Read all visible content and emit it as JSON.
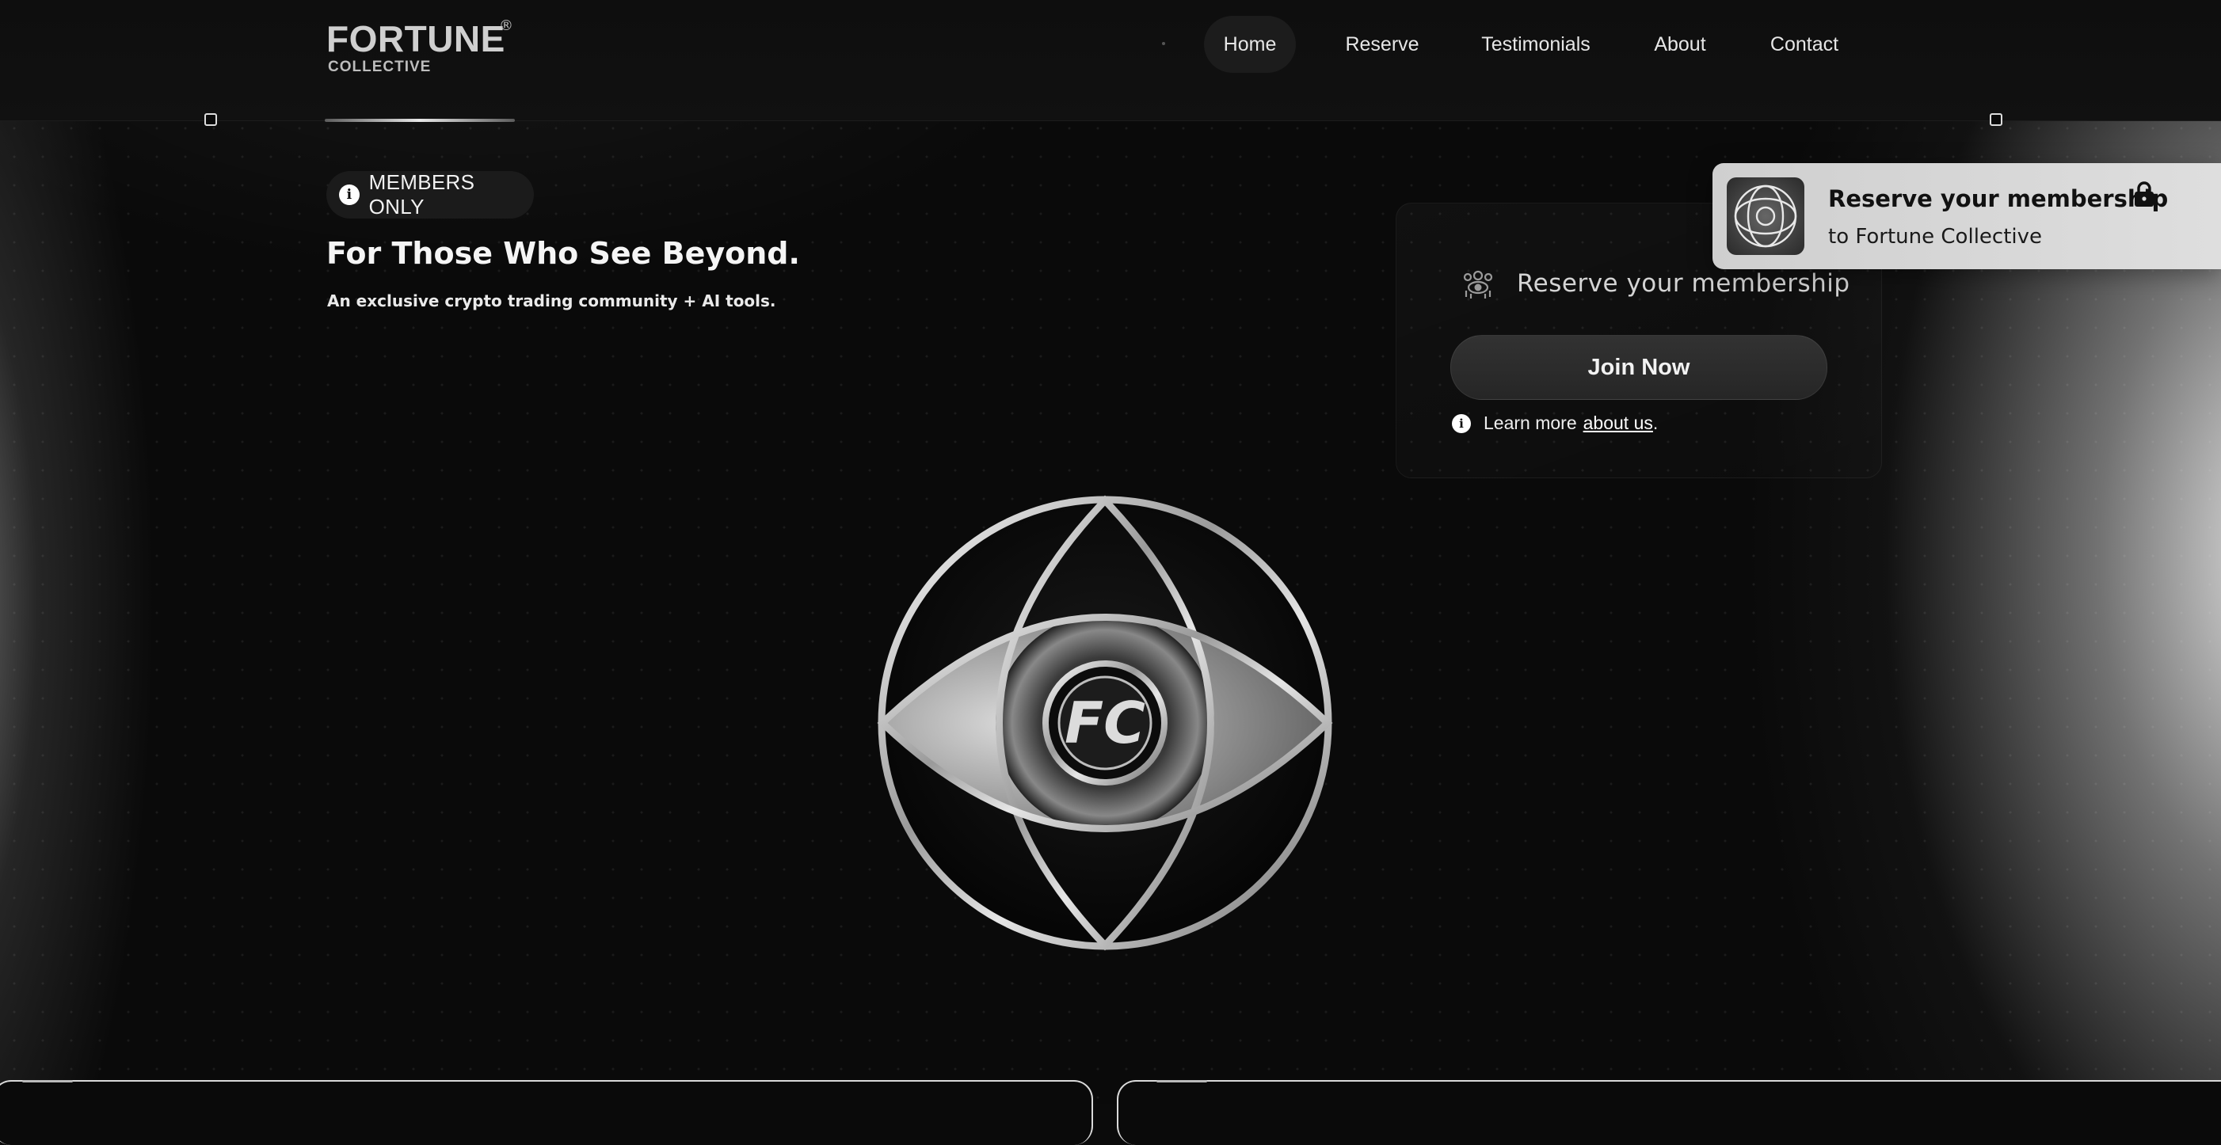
{
  "brand": {
    "name": "FORTUNE",
    "registered": "®",
    "tagline": "COLLECTIVE"
  },
  "nav": {
    "items": [
      {
        "label": "Home",
        "active": true
      },
      {
        "label": "Reserve",
        "active": false
      },
      {
        "label": "Testimonials",
        "active": false
      },
      {
        "label": "About",
        "active": false
      },
      {
        "label": "Contact",
        "active": false
      }
    ]
  },
  "hero": {
    "badge_label": "MEMBERS ONLY",
    "badge_icon": "info-icon",
    "title": "For Those Who See Beyond.",
    "subtitle": "An exclusive crypto trading community + AI tools."
  },
  "card": {
    "icon": "members-icon",
    "title": "Reserve your membership",
    "button_label": "Join Now",
    "learn_prefix": "Learn more",
    "learn_link": "about us",
    "learn_suffix": "."
  },
  "toast": {
    "title": "Reserve your membership",
    "subtitle": "to Fortune Collective",
    "icon": "lock-icon"
  },
  "emblem": {
    "monogram": "FC"
  },
  "colors": {
    "background": "#0b0b0b",
    "accent": "#ffffff",
    "toast_bg": "#d6d6d6"
  }
}
